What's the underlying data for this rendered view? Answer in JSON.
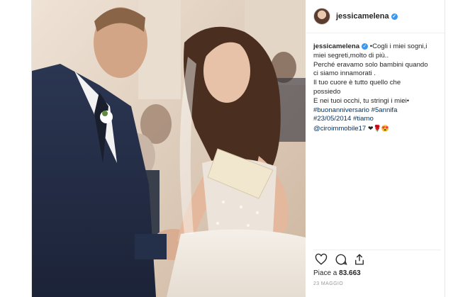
{
  "post": {
    "username": "jessicamelena",
    "caption": {
      "username": "jessicamelena",
      "lines": [
        "•Cogli i miei sogni,i",
        "miei segreti,molto di più..",
        "Perché eravamo solo bambini quando",
        "ci siamo innamorati .",
        "Il tuo cuore è tutto quello che",
        "possiedo",
        "E nei tuoi occhi, tu stringi i miei•"
      ],
      "hashtags_1": "#buonanniversario #5annifa",
      "hashtags_2": "#23/05/2014 #tiamo",
      "mention": "@ciroimmobile17",
      "emojis": "❤🌹😍"
    },
    "likes_label": "Piace a",
    "likes_count": "83.663",
    "date": "23 MAGGIO"
  },
  "colors": {
    "verified": "#3897f0",
    "hashtag": "#003569",
    "border": "#efefef"
  },
  "icons": {
    "like": "heart-icon",
    "comment": "comment-icon",
    "share": "share-icon",
    "verified": "verified-badge-icon"
  }
}
